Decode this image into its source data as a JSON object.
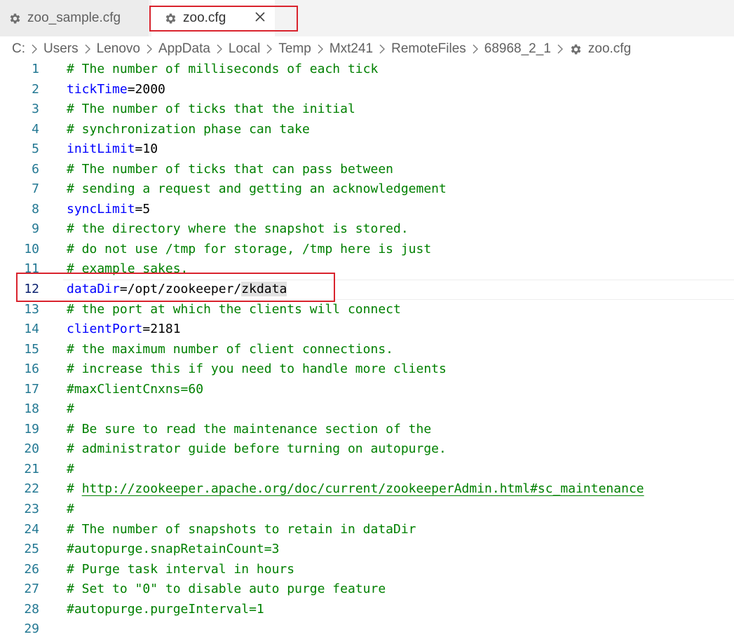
{
  "tabs": [
    {
      "label": "zoo_sample.cfg",
      "icon": "gear-icon",
      "active": false
    },
    {
      "label": "zoo.cfg",
      "icon": "gear-icon",
      "active": true,
      "close_glyph": "×"
    }
  ],
  "breadcrumb": {
    "segments": [
      "C:",
      "Users",
      "Lenovo",
      "AppData",
      "Local",
      "Temp",
      "Mxt241",
      "RemoteFiles",
      "68968_2_1"
    ],
    "file": "zoo.cfg"
  },
  "editor": {
    "current_line": 12,
    "lines": [
      {
        "n": "1",
        "comment": "# The number of milliseconds of each tick"
      },
      {
        "n": "2",
        "key": "tickTime",
        "eq": "=",
        "value": "2000"
      },
      {
        "n": "3",
        "comment": "# The number of ticks that the initial"
      },
      {
        "n": "4",
        "comment": "# synchronization phase can take"
      },
      {
        "n": "5",
        "key": "initLimit",
        "eq": "=",
        "value": "10"
      },
      {
        "n": "6",
        "comment": "# The number of ticks that can pass between"
      },
      {
        "n": "7",
        "comment": "# sending a request and getting an acknowledgement"
      },
      {
        "n": "8",
        "key": "syncLimit",
        "eq": "=",
        "value": "5"
      },
      {
        "n": "9",
        "comment": "# the directory where the snapshot is stored."
      },
      {
        "n": "10",
        "comment": "# do not use /tmp for storage, /tmp here is just"
      },
      {
        "n": "11",
        "comment": "# example sakes."
      },
      {
        "n": "12",
        "key": "dataDir",
        "eq": "=",
        "value": "/opt/zookeeper/",
        "selected": "zkdata"
      },
      {
        "n": "13",
        "comment": "# the port at which the clients will connect"
      },
      {
        "n": "14",
        "key": "clientPort",
        "eq": "=",
        "value": "2181"
      },
      {
        "n": "15",
        "comment": "# the maximum number of client connections."
      },
      {
        "n": "16",
        "comment": "# increase this if you need to handle more clients"
      },
      {
        "n": "17",
        "comment": "#maxClientCnxns=60"
      },
      {
        "n": "18",
        "comment": "#"
      },
      {
        "n": "19",
        "comment": "# Be sure to read the maintenance section of the"
      },
      {
        "n": "20",
        "comment": "# administrator guide before turning on autopurge."
      },
      {
        "n": "21",
        "comment": "#"
      },
      {
        "n": "22",
        "comment": "# ",
        "link": "http://zookeeper.apache.org/doc/current/zookeeperAdmin.html#sc_maintenance"
      },
      {
        "n": "23",
        "comment": "#"
      },
      {
        "n": "24",
        "comment": "# The number of snapshots to retain in dataDir"
      },
      {
        "n": "25",
        "comment": "#autopurge.snapRetainCount=3"
      },
      {
        "n": "26",
        "comment": "# Purge task interval in hours"
      },
      {
        "n": "27",
        "comment": "# Set to \"0\" to disable auto purge feature"
      },
      {
        "n": "28",
        "comment": "#autopurge.purgeInterval=1"
      },
      {
        "n": "29",
        "comment": ""
      }
    ]
  },
  "colors": {
    "comment": "#008000",
    "key": "#0000ff",
    "line_number": "#237893",
    "highlight_box": "#d9232d"
  }
}
